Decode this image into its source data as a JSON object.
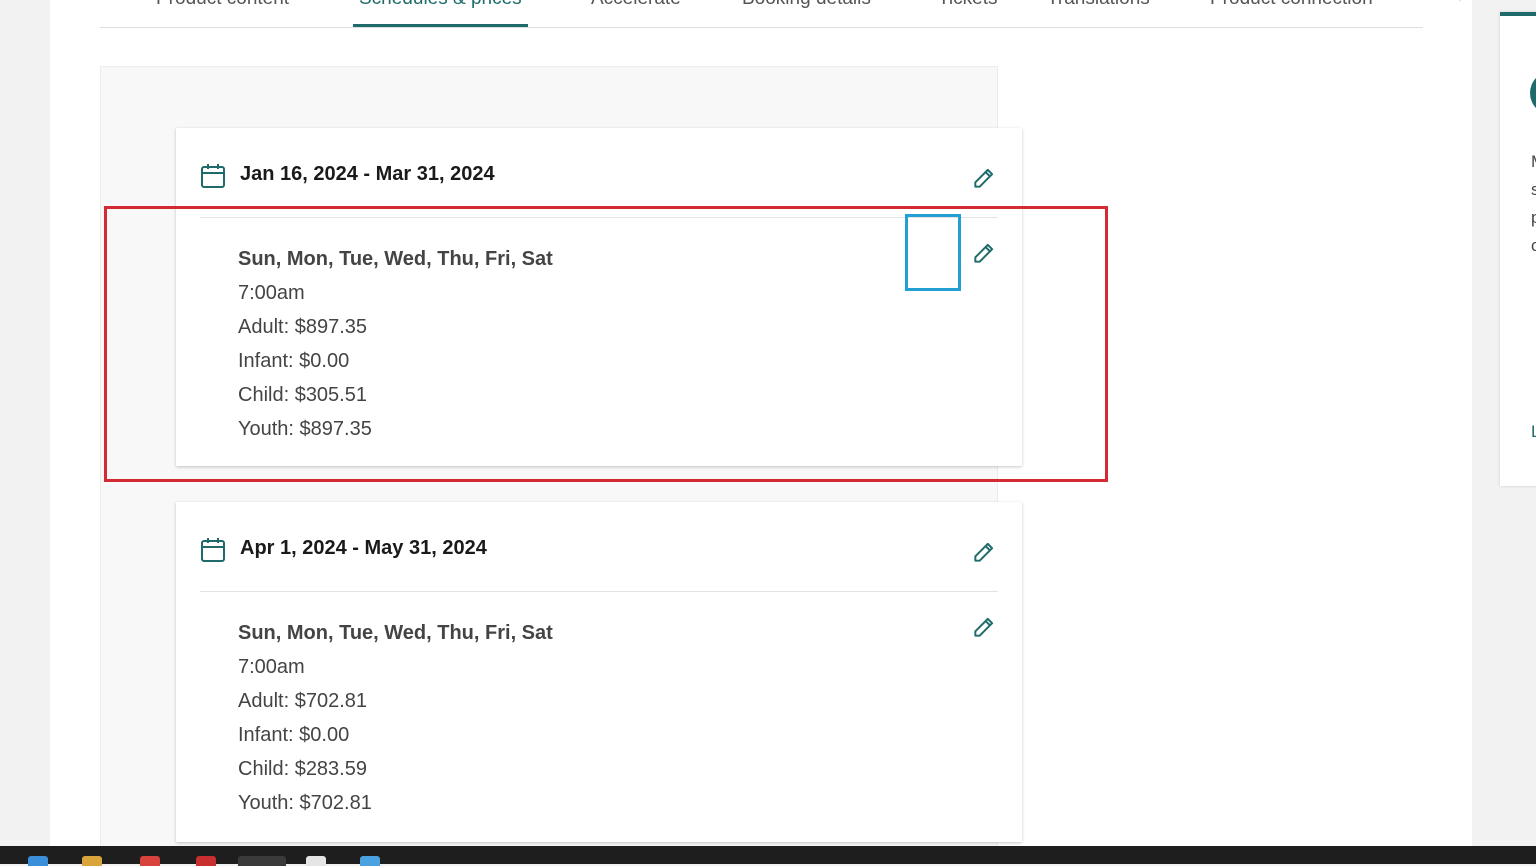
{
  "tabs": [
    {
      "label": "Product content",
      "active": false
    },
    {
      "label": "Schedules & prices",
      "active": true
    },
    {
      "label": "Accelerate",
      "active": false
    },
    {
      "label": "Booking details",
      "active": false
    },
    {
      "label": "Tickets",
      "active": false
    },
    {
      "label": "Translations",
      "active": false
    },
    {
      "label": "Product connection",
      "active": false
    }
  ],
  "schedules": [
    {
      "date_range": "Jan 16, 2024 - Mar 31, 2024",
      "days": "Sun, Mon, Tue, Wed, Thu, Fri, Sat",
      "time": "7:00am",
      "prices": [
        "Adult: $897.35",
        "Infant: $0.00",
        "Child: $305.51",
        "Youth: $897.35"
      ]
    },
    {
      "date_range": "Apr 1, 2024 - May 31, 2024",
      "days": "Sun, Mon, Tue, Wed, Thu, Fri, Sat",
      "time": "7:00am",
      "prices": [
        "Adult: $702.81",
        "Infant: $0.00",
        "Child: $283.59",
        "Youth: $702.81"
      ]
    }
  ],
  "side_panel": {
    "lines": [
      "M",
      "s",
      "p",
      "c"
    ],
    "link": "L"
  },
  "colors": {
    "accent": "#1f6b6b",
    "highlight_red": "#d42a34",
    "highlight_blue": "#22a0d4"
  }
}
